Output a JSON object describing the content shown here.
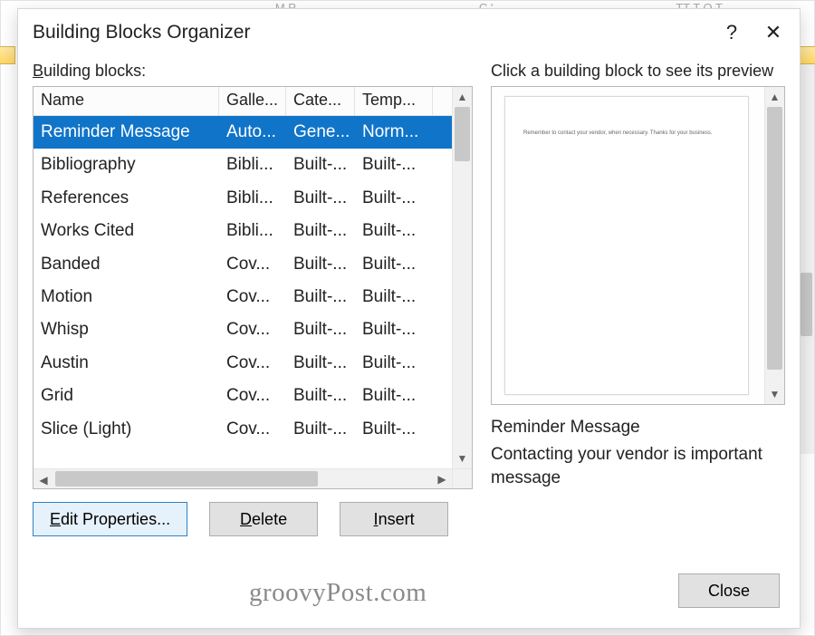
{
  "ribbon_hints": [
    "",
    "M   P",
    "C          '",
    "TT    T    O   T"
  ],
  "dialog": {
    "title": "Building Blocks Organizer",
    "help_label": "?",
    "close_icon_label": "✕"
  },
  "left": {
    "label": "Building blocks:",
    "columns": {
      "name": "Name",
      "gallery": "Galle...",
      "category": "Cate...",
      "template": "Temp..."
    },
    "rows": [
      {
        "name": "Reminder Message",
        "gallery": "Auto...",
        "category": "Gene...",
        "template": "Norm...",
        "selected": true
      },
      {
        "name": "Bibliography",
        "gallery": "Bibli...",
        "category": "Built-...",
        "template": "Built-..."
      },
      {
        "name": "References",
        "gallery": "Bibli...",
        "category": "Built-...",
        "template": "Built-..."
      },
      {
        "name": "Works Cited",
        "gallery": "Bibli...",
        "category": "Built-...",
        "template": "Built-..."
      },
      {
        "name": "Banded",
        "gallery": "Cov...",
        "category": "Built-...",
        "template": "Built-..."
      },
      {
        "name": "Motion",
        "gallery": "Cov...",
        "category": "Built-...",
        "template": "Built-..."
      },
      {
        "name": "Whisp",
        "gallery": "Cov...",
        "category": "Built-...",
        "template": "Built-..."
      },
      {
        "name": "Austin",
        "gallery": "Cov...",
        "category": "Built-...",
        "template": "Built-..."
      },
      {
        "name": "Grid",
        "gallery": "Cov...",
        "category": "Built-...",
        "template": "Built-..."
      },
      {
        "name": "Slice (Light)",
        "gallery": "Cov...",
        "category": "Built-...",
        "template": "Built-..."
      }
    ],
    "buttons": {
      "edit": "Edit Properties...",
      "delete": "Delete",
      "insert": "Insert"
    }
  },
  "right": {
    "label": "Click a building block to see its preview",
    "preview_text": "Remember to contact your vendor, when necessary. Thanks for your business.",
    "item_name": "Reminder Message",
    "item_desc": "Contacting your vendor is important message"
  },
  "footer": {
    "close": "Close"
  },
  "watermark": "groovyPost.com"
}
